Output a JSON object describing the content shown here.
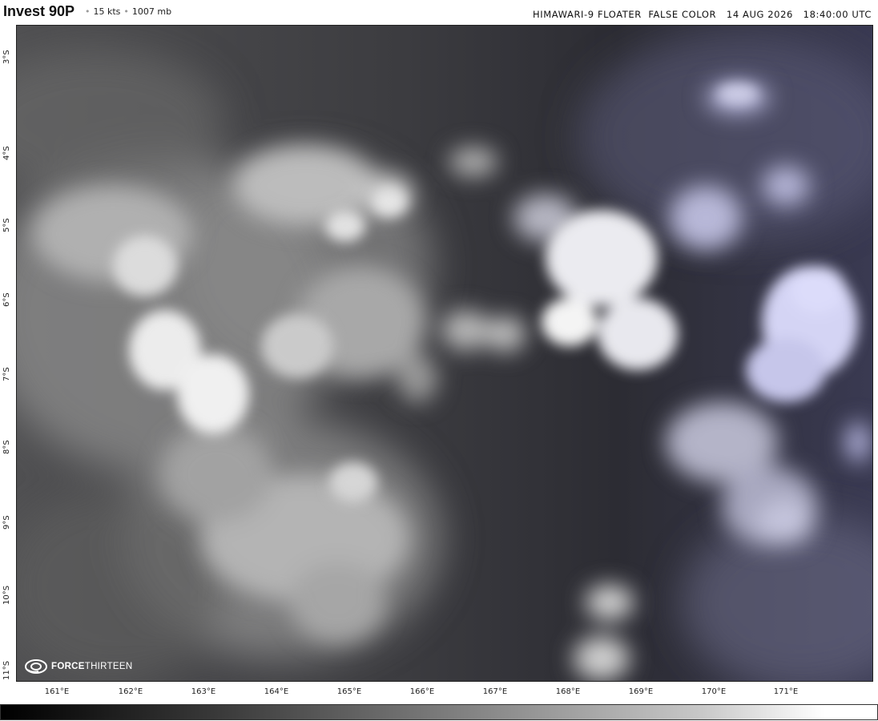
{
  "header": {
    "storm_name": "Invest 90P",
    "wind": "15 kts",
    "pressure": "1007 mb",
    "source_line": "HIMAWARI-9 FLOATER  FALSE COLOR   14 AUG 2026   18:40:00 UTC"
  },
  "map": {
    "latitude_labels": [
      "3°S",
      "4°S",
      "5°S",
      "6°S",
      "7°S",
      "8°S",
      "9°S",
      "10°S",
      "11°S"
    ],
    "longitude_labels": [
      "161°E",
      "162°E",
      "163°E",
      "164°E",
      "165°E",
      "166°E",
      "167°E",
      "168°E",
      "169°E",
      "170°E",
      "171°E"
    ],
    "lat_range": [
      -2.3,
      -11.2
    ],
    "lon_range": [
      160.5,
      172.3
    ],
    "colors": {
      "ocean_dark": "#2e2e33",
      "cloud_bright": "#f2f2f2",
      "cloud_cold_tint": "#c6c8f6"
    }
  },
  "logo": {
    "brand_bold": "FORCE",
    "brand_light": "THIRTEEN",
    "icon": "cyclone-icon"
  },
  "colorbar": {
    "low_color": "#000000",
    "high_color": "#ffffff"
  }
}
